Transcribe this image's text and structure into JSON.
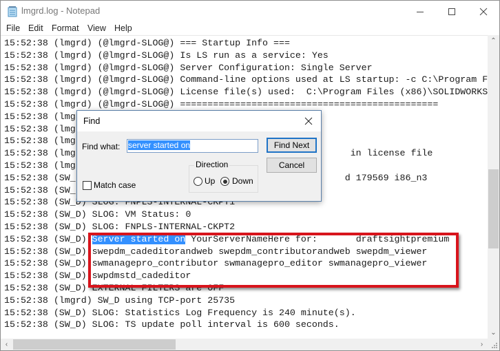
{
  "window": {
    "title": "lmgrd.log - Notepad",
    "controls": {
      "minimize": "minimize",
      "maximize": "maximize",
      "close": "close"
    }
  },
  "menu": [
    "File",
    "Edit",
    "Format",
    "View",
    "Help"
  ],
  "log_lines": [
    "15:52:38 (lmgrd) (@lmgrd-SLOG@) === Startup Info ===",
    "15:52:38 (lmgrd) (@lmgrd-SLOG@) Is LS run as a service: Yes",
    "15:52:38 (lmgrd) (@lmgrd-SLOG@) Server Configuration: Single Server",
    "15:52:38 (lmgrd) (@lmgrd-SLOG@) Command-line options used at LS startup: -c C:\\Program Files",
    "15:52:38 (lmgrd) (@lmgrd-SLOG@) License file(s) used:  C:\\Program Files (x86)\\SOLIDWORKS",
    "15:52:38 (lmgrd) (@lmgrd-SLOG@) ===============================================",
    "15:52:38 (lmg",
    "15:52:38 (lmg",
    "15:52:38 (lmg",
    "15:52:38 (lmg                                                  in license file",
    "15:52:38 (lmg",
    "15:52:38 (SW_                                                 d 179569 i86_n3",
    "15:52:38 (SW_",
    "15:52:38 (SW_D) SLOG: FNPLS-INTERNAL-CKPT1",
    "15:52:38 (SW_D) SLOG: VM Status: 0",
    "15:52:38 (SW_D) SLOG: FNPLS-INTERNAL-CKPT2",
    "__HL__",
    "15:52:38 (SW_D) swepdm_cadeditorandweb swepdm_contributorandweb swepdm_viewer",
    "15:52:38 (SW_D) swmanagepro_contributor swmanagepro_editor swmanagepro_viewer",
    "15:52:38 (SW_D) swpdmstd_cadeditor",
    "15:52:38 (SW_D) EXTERNAL FILTERS are OFF",
    "15:52:38 (lmgrd) SW_D using TCP-port 25735",
    "15:52:38 (SW_D) SLOG: Statistics Log Frequency is 240 minute(s).",
    "15:52:38 (SW_D) SLOG: TS update poll interval is 600 seconds."
  ],
  "highlight_line": {
    "prefix": "15:52:38 (SW_D) ",
    "match": "Server started on",
    "suffix": " YourServerNameHere for:       draftsightpremium"
  },
  "find_dialog": {
    "title": "Find",
    "find_what_label": "Find what:",
    "find_what_value": "server started on",
    "find_next_label": "Find Next",
    "cancel_label": "Cancel",
    "direction_label": "Direction",
    "up_label": "Up",
    "down_label": "Down",
    "direction_selected": "Down",
    "match_case_label": "Match case",
    "match_case_checked": false
  },
  "annotation": {
    "box_color": "#d8141c"
  },
  "colors": {
    "selection": "#3390ff",
    "dialog_bg": "#f0f0f0"
  }
}
